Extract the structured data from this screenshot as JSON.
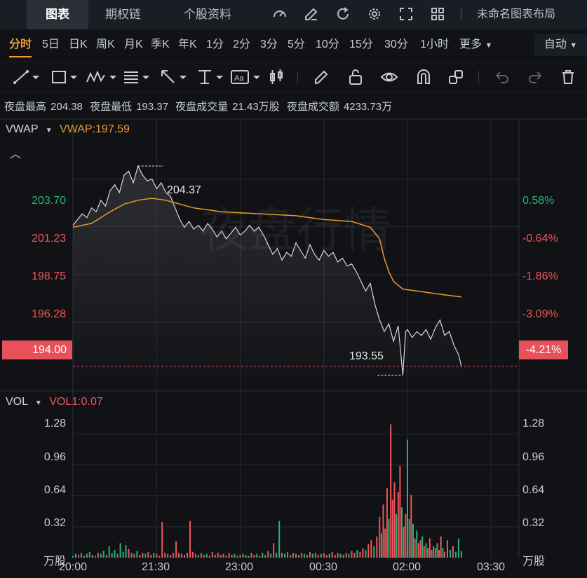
{
  "nav": {
    "tabs": [
      "图表",
      "期权链",
      "个股资料"
    ],
    "layout_label": "未命名图表布局"
  },
  "periods": [
    "分时",
    "5日",
    "日K",
    "周K",
    "月K",
    "季K",
    "年K",
    "1分",
    "2分",
    "3分",
    "5分",
    "10分",
    "15分",
    "30分",
    "1小时"
  ],
  "more_label": "更多",
  "auto_label": "自动",
  "stats": {
    "high_label": "夜盘最高",
    "high_value": "204.38",
    "low_label": "夜盘最低",
    "low_value": "193.37",
    "vol_label": "夜盘成交量",
    "vol_value": "21.43万股",
    "amt_label": "夜盘成交额",
    "amt_value": "4233.73万"
  },
  "indicator": {
    "name": "VWAP",
    "value_label": "VWAP:197.59"
  },
  "vol_indicator": {
    "name": "VOL",
    "value_label": "VOL1:0.07",
    "unit": "万股"
  },
  "watermark": "夜盘行情",
  "colors": {
    "up": "#26b37a",
    "down": "#f0555a",
    "vwap": "#e89a2a",
    "price": "#d6d9de",
    "accent": "#f0a030"
  },
  "chart_data": {
    "type": "line",
    "price_axis": {
      "left_ticks": [
        "203.70",
        "201.23",
        "198.75",
        "196.28"
      ],
      "right_ticks": [
        "0.58%",
        "-0.64%",
        "-1.86%",
        "-3.09%"
      ],
      "current_price": "194.00",
      "current_pct": "-4.21%",
      "ylim": [
        192.8,
        206.8
      ]
    },
    "annotations": {
      "max_label": "204.37",
      "min_label": "193.55"
    },
    "x_ticks": [
      "20:00",
      "21:30",
      "23:00",
      "00:30",
      "02:00",
      "03:30"
    ],
    "x_range_minutes": [
      0,
      480
    ],
    "price": [
      [
        0,
        201.3
      ],
      [
        5,
        201.6
      ],
      [
        10,
        201.9
      ],
      [
        15,
        201.7
      ],
      [
        20,
        202.2
      ],
      [
        25,
        202.0
      ],
      [
        30,
        202.6
      ],
      [
        35,
        202.3
      ],
      [
        40,
        203.1
      ],
      [
        45,
        203.4
      ],
      [
        50,
        203.0
      ],
      [
        55,
        203.9
      ],
      [
        60,
        204.1
      ],
      [
        65,
        203.5
      ],
      [
        70,
        204.37
      ],
      [
        75,
        203.9
      ],
      [
        80,
        203.6
      ],
      [
        85,
        203.7
      ],
      [
        90,
        203.2
      ],
      [
        95,
        203.5
      ],
      [
        100,
        203.0
      ],
      [
        105,
        202.8
      ],
      [
        110,
        202.2
      ],
      [
        115,
        201.6
      ],
      [
        120,
        201.2
      ],
      [
        125,
        201.5
      ],
      [
        130,
        201.1
      ],
      [
        135,
        201.3
      ],
      [
        140,
        201.0
      ],
      [
        145,
        201.4
      ],
      [
        150,
        201.1
      ],
      [
        155,
        200.7
      ],
      [
        160,
        201.0
      ],
      [
        165,
        200.6
      ],
      [
        170,
        200.9
      ],
      [
        175,
        201.2
      ],
      [
        180,
        200.8
      ],
      [
        185,
        201.0
      ],
      [
        190,
        201.3
      ],
      [
        195,
        201.0
      ],
      [
        200,
        201.2
      ],
      [
        205,
        200.8
      ],
      [
        210,
        200.3
      ],
      [
        215,
        199.8
      ],
      [
        220,
        200.1
      ],
      [
        225,
        199.5
      ],
      [
        230,
        199.9
      ],
      [
        235,
        199.7
      ],
      [
        240,
        200.4
      ],
      [
        245,
        200.0
      ],
      [
        250,
        199.6
      ],
      [
        255,
        200.3
      ],
      [
        260,
        199.8
      ],
      [
        265,
        199.5
      ],
      [
        270,
        200.0
      ],
      [
        275,
        199.7
      ],
      [
        280,
        199.9
      ],
      [
        285,
        199.4
      ],
      [
        290,
        199.6
      ],
      [
        295,
        199.2
      ],
      [
        300,
        199.3
      ],
      [
        305,
        198.9
      ],
      [
        310,
        198.4
      ],
      [
        315,
        197.9
      ],
      [
        320,
        198.3
      ],
      [
        325,
        197.2
      ],
      [
        330,
        196.4
      ],
      [
        335,
        195.8
      ],
      [
        340,
        196.2
      ],
      [
        345,
        195.3
      ],
      [
        350,
        196.1
      ],
      [
        355,
        193.55
      ],
      [
        358,
        195.8
      ],
      [
        360,
        195.9
      ],
      [
        365,
        195.5
      ],
      [
        370,
        195.8
      ],
      [
        375,
        195.6
      ],
      [
        380,
        195.9
      ],
      [
        385,
        195.4
      ],
      [
        390,
        196.0
      ],
      [
        395,
        196.4
      ],
      [
        400,
        195.6
      ],
      [
        405,
        195.8
      ],
      [
        410,
        195.1
      ],
      [
        415,
        194.6
      ],
      [
        418,
        194.0
      ]
    ],
    "vwap": [
      [
        0,
        201.2
      ],
      [
        20,
        201.4
      ],
      [
        40,
        202.0
      ],
      [
        55,
        202.4
      ],
      [
        70,
        202.6
      ],
      [
        85,
        202.7
      ],
      [
        100,
        202.6
      ],
      [
        115,
        202.4
      ],
      [
        130,
        202.2
      ],
      [
        160,
        202.0
      ],
      [
        200,
        201.9
      ],
      [
        240,
        201.8
      ],
      [
        270,
        201.6
      ],
      [
        300,
        201.5
      ],
      [
        320,
        201.2
      ],
      [
        330,
        200.6
      ],
      [
        335,
        199.6
      ],
      [
        340,
        198.9
      ],
      [
        345,
        198.4
      ],
      [
        355,
        198.0
      ],
      [
        370,
        197.9
      ],
      [
        400,
        197.7
      ],
      [
        418,
        197.59
      ]
    ],
    "volume_axis": {
      "ticks": [
        "1.28",
        "0.96",
        "0.64",
        "0.32"
      ],
      "ylim": [
        0,
        1.42
      ]
    },
    "volume": [
      [
        0,
        0.02,
        1
      ],
      [
        3,
        0.04,
        1
      ],
      [
        6,
        0.03,
        0
      ],
      [
        9,
        0.05,
        1
      ],
      [
        12,
        0.02,
        0
      ],
      [
        15,
        0.04,
        1
      ],
      [
        18,
        0.06,
        1
      ],
      [
        21,
        0.03,
        0
      ],
      [
        24,
        0.02,
        1
      ],
      [
        27,
        0.05,
        0
      ],
      [
        30,
        0.04,
        1
      ],
      [
        33,
        0.07,
        1
      ],
      [
        36,
        0.03,
        0
      ],
      [
        39,
        0.12,
        1
      ],
      [
        42,
        0.05,
        1
      ],
      [
        45,
        0.08,
        1
      ],
      [
        48,
        0.04,
        0
      ],
      [
        51,
        0.15,
        1
      ],
      [
        54,
        0.06,
        1
      ],
      [
        57,
        0.13,
        1
      ],
      [
        60,
        0.09,
        0
      ],
      [
        63,
        0.05,
        1
      ],
      [
        66,
        0.04,
        0
      ],
      [
        69,
        0.07,
        1
      ],
      [
        72,
        0.03,
        0
      ],
      [
        75,
        0.05,
        0
      ],
      [
        78,
        0.04,
        1
      ],
      [
        81,
        0.06,
        0
      ],
      [
        84,
        0.03,
        0
      ],
      [
        87,
        0.05,
        1
      ],
      [
        90,
        0.04,
        0
      ],
      [
        93,
        0.02,
        0
      ],
      [
        96,
        0.37,
        0
      ],
      [
        99,
        0.05,
        0
      ],
      [
        102,
        0.04,
        1
      ],
      [
        105,
        0.03,
        0
      ],
      [
        108,
        0.05,
        0
      ],
      [
        111,
        0.17,
        0
      ],
      [
        114,
        0.05,
        0
      ],
      [
        117,
        0.04,
        1
      ],
      [
        120,
        0.03,
        0
      ],
      [
        123,
        0.05,
        0
      ],
      [
        126,
        0.38,
        0
      ],
      [
        129,
        0.06,
        0
      ],
      [
        132,
        0.04,
        0
      ],
      [
        135,
        0.03,
        1
      ],
      [
        138,
        0.05,
        0
      ],
      [
        141,
        0.03,
        0
      ],
      [
        144,
        0.04,
        1
      ],
      [
        147,
        0.02,
        0
      ],
      [
        150,
        0.06,
        0
      ],
      [
        153,
        0.03,
        1
      ],
      [
        156,
        0.05,
        0
      ],
      [
        159,
        0.03,
        0
      ],
      [
        162,
        0.04,
        1
      ],
      [
        165,
        0.02,
        0
      ],
      [
        168,
        0.05,
        0
      ],
      [
        171,
        0.03,
        0
      ],
      [
        174,
        0.04,
        1
      ],
      [
        177,
        0.02,
        0
      ],
      [
        180,
        0.03,
        0
      ],
      [
        183,
        0.04,
        1
      ],
      [
        186,
        0.03,
        0
      ],
      [
        189,
        0.02,
        1
      ],
      [
        192,
        0.05,
        0
      ],
      [
        195,
        0.03,
        0
      ],
      [
        198,
        0.04,
        1
      ],
      [
        201,
        0.02,
        0
      ],
      [
        204,
        0.05,
        1
      ],
      [
        207,
        0.03,
        0
      ],
      [
        210,
        0.07,
        0
      ],
      [
        213,
        0.04,
        1
      ],
      [
        216,
        0.15,
        0
      ],
      [
        219,
        0.05,
        1
      ],
      [
        222,
        0.38,
        1
      ],
      [
        225,
        0.05,
        0
      ],
      [
        228,
        0.04,
        1
      ],
      [
        231,
        0.06,
        0
      ],
      [
        234,
        0.03,
        1
      ],
      [
        237,
        0.05,
        0
      ],
      [
        240,
        0.04,
        0
      ],
      [
        243,
        0.03,
        1
      ],
      [
        246,
        0.05,
        0
      ],
      [
        249,
        0.04,
        1
      ],
      [
        252,
        0.03,
        0
      ],
      [
        255,
        0.06,
        0
      ],
      [
        258,
        0.04,
        1
      ],
      [
        261,
        0.05,
        0
      ],
      [
        264,
        0.03,
        0
      ],
      [
        267,
        0.04,
        1
      ],
      [
        270,
        0.05,
        0
      ],
      [
        273,
        0.03,
        0
      ],
      [
        276,
        0.04,
        1
      ],
      [
        279,
        0.06,
        0
      ],
      [
        282,
        0.03,
        0
      ],
      [
        285,
        0.05,
        0
      ],
      [
        288,
        0.04,
        1
      ],
      [
        291,
        0.03,
        0
      ],
      [
        294,
        0.05,
        0
      ],
      [
        297,
        0.04,
        1
      ],
      [
        300,
        0.07,
        0
      ],
      [
        303,
        0.05,
        0
      ],
      [
        306,
        0.08,
        1
      ],
      [
        309,
        0.06,
        0
      ],
      [
        312,
        0.1,
        0
      ],
      [
        315,
        0.08,
        1
      ],
      [
        318,
        0.14,
        0
      ],
      [
        321,
        0.18,
        0
      ],
      [
        324,
        0.12,
        1
      ],
      [
        327,
        0.22,
        0
      ],
      [
        330,
        0.42,
        0
      ],
      [
        332,
        0.25,
        1
      ],
      [
        334,
        0.55,
        0
      ],
      [
        336,
        0.3,
        0
      ],
      [
        338,
        0.72,
        0
      ],
      [
        340,
        0.4,
        1
      ],
      [
        342,
        1.38,
        0
      ],
      [
        344,
        0.6,
        0
      ],
      [
        346,
        0.78,
        0
      ],
      [
        348,
        0.45,
        1
      ],
      [
        350,
        0.68,
        0
      ],
      [
        352,
        0.95,
        0
      ],
      [
        354,
        0.52,
        1
      ],
      [
        356,
        0.32,
        0
      ],
      [
        358,
        0.45,
        0
      ],
      [
        360,
        1.22,
        1
      ],
      [
        362,
        0.4,
        1
      ],
      [
        364,
        0.65,
        0
      ],
      [
        366,
        0.35,
        1
      ],
      [
        368,
        0.2,
        0
      ],
      [
        370,
        0.28,
        1
      ],
      [
        372,
        0.15,
        0
      ],
      [
        374,
        0.18,
        0
      ],
      [
        376,
        0.22,
        1
      ],
      [
        378,
        0.12,
        0
      ],
      [
        380,
        0.15,
        1
      ],
      [
        382,
        0.1,
        0
      ],
      [
        384,
        0.2,
        0
      ],
      [
        386,
        0.08,
        1
      ],
      [
        388,
        0.12,
        0
      ],
      [
        390,
        0.1,
        0
      ],
      [
        392,
        0.15,
        1
      ],
      [
        394,
        0.08,
        0
      ],
      [
        396,
        0.22,
        0
      ],
      [
        398,
        0.1,
        1
      ],
      [
        400,
        0.06,
        0
      ],
      [
        403,
        0.18,
        0
      ],
      [
        406,
        0.08,
        1
      ],
      [
        409,
        0.12,
        0
      ],
      [
        412,
        0.06,
        1
      ],
      [
        415,
        0.2,
        1
      ],
      [
        418,
        0.07,
        1
      ]
    ]
  }
}
